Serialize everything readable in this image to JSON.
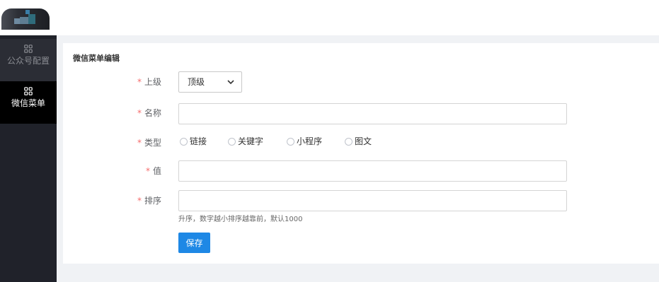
{
  "sidebar": {
    "items": [
      {
        "label": "公众号配置",
        "icon": "grid-icon",
        "active": false
      },
      {
        "label": "微信菜单",
        "icon": "grid-icon",
        "active": true
      }
    ]
  },
  "form": {
    "title": "微信菜单编辑",
    "required_mark": "*",
    "parent": {
      "label": "上级",
      "value": "顶级"
    },
    "name": {
      "label": "名称",
      "value": "",
      "placeholder": ""
    },
    "type": {
      "label": "类型",
      "options": [
        "链接",
        "关键字",
        "小程序",
        "图文"
      ]
    },
    "value": {
      "label": "值",
      "value": "",
      "placeholder": ""
    },
    "sort": {
      "label": "排序",
      "value": "",
      "placeholder": "",
      "hint": "升序，数字越小排序越靠前，默认1000"
    },
    "save_label": "保存"
  },
  "colors": {
    "primary": "#1e88e5",
    "required": "#f56c6c",
    "sidebar_bg": "#20222a",
    "sidebar_active_bg": "#000000"
  }
}
